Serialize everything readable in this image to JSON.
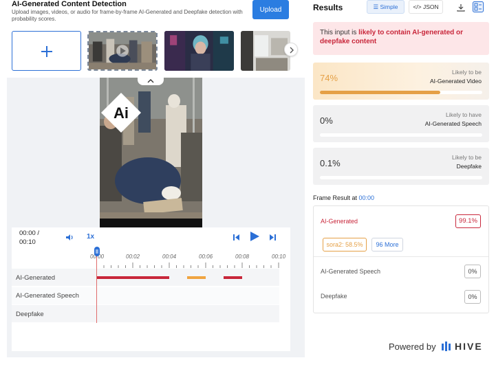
{
  "header": {
    "title": "AI-Generated Content Detection",
    "subtitle": "Upload images, videos, or audio for frame-by-frame AI-Generated and Deepfake detection with probability scores.",
    "upload_label": "Upload"
  },
  "player": {
    "time_current": "00:00 /",
    "time_total": "00:10",
    "speed": "1x",
    "ticks": [
      "00:00",
      "00:02",
      "00:04",
      "00:06",
      "00:08",
      "00:10"
    ],
    "tracks": [
      {
        "label": "AI-Generated"
      },
      {
        "label": "AI-Generated Speech"
      },
      {
        "label": "Deepfake"
      }
    ],
    "badge_text": "Ai"
  },
  "results": {
    "title": "Results",
    "tab_simple": "Simple",
    "tab_json": "</> JSON",
    "alert_prefix": "This input is ",
    "alert_emphasis": "likely to contain AI-generated or deepfake content",
    "cards": [
      {
        "pct": "74%",
        "value": 0.74,
        "line1": "Likely to be",
        "line2": "AI-Generated Video"
      },
      {
        "pct": "0%",
        "value": 0.0,
        "line1": "Likely to have",
        "line2": "AI-Generated Speech"
      },
      {
        "pct": "0.1%",
        "value": 0.001,
        "line1": "Likely to be",
        "line2": "Deepfake"
      }
    ],
    "frame_label": "Frame Result at ",
    "frame_time": "00:00",
    "frame": {
      "ai_label": "AI-Generated",
      "ai_score": "99.1%",
      "chip_sora": "sora2: 58.5%",
      "chip_more": "96 More",
      "speech_label": "AI-Generated Speech",
      "speech_score": "0%",
      "deep_label": "Deepfake",
      "deep_score": "0%"
    }
  },
  "footer": {
    "powered_by": "Powered by",
    "brand": "HIVE"
  },
  "colors": {
    "accent": "#2b6fd6",
    "alert": "#c8263a",
    "warning": "#e5a046"
  }
}
